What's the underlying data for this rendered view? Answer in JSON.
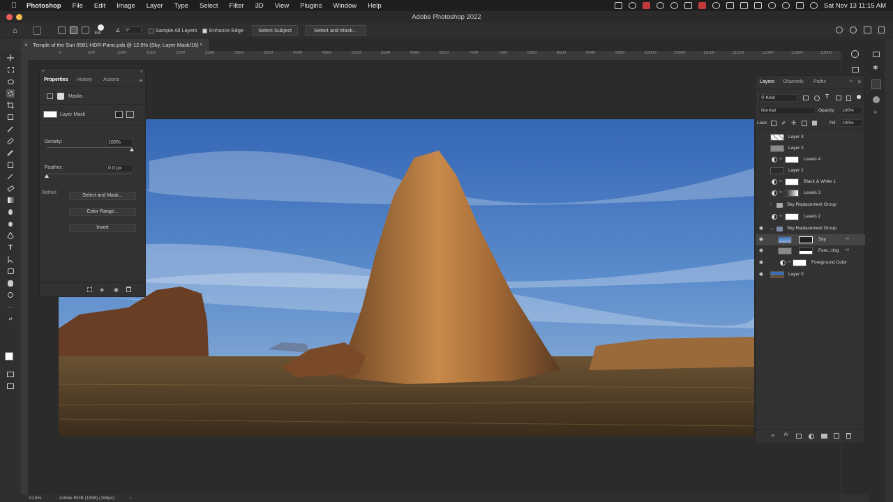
{
  "menubar": {
    "app": "Photoshop",
    "items": [
      "File",
      "Edit",
      "Image",
      "Layer",
      "Type",
      "Select",
      "Filter",
      "3D",
      "View",
      "Plugins",
      "Window",
      "Help"
    ],
    "clock": "Sat Nov 13  11:15 AM"
  },
  "window": {
    "title": "Adobe Photoshop 2022"
  },
  "options_bar": {
    "brush_size": "800",
    "angle": "0°",
    "sample_all_layers": "Sample All Layers",
    "enhance_edge": "Enhance Edge",
    "select_subject": "Select Subject",
    "select_and_mask": "Select and Mask..."
  },
  "document": {
    "tab_title": "Temple of the Sun 0581-HDR-Pano.psb @ 12.5% (Sky, Layer Mask/16) *"
  },
  "ruler": {
    "ticks": [
      "0",
      "500",
      "1000",
      "1500",
      "2000",
      "2500",
      "3000",
      "3500",
      "4000",
      "4500",
      "5000",
      "5500",
      "6000",
      "6500",
      "7000",
      "7500",
      "8000",
      "8500",
      "9000",
      "9500",
      "10000",
      "10500",
      "11000",
      "11500",
      "12000",
      "12500",
      "13000"
    ]
  },
  "properties": {
    "tabs": [
      "Properties",
      "History",
      "Actions"
    ],
    "masks_label": "Masks",
    "layer_mask_label": "Layer Mask",
    "density_label": "Density:",
    "density_value": "100%",
    "density_fraction": 1.0,
    "feather_label": "Feather:",
    "feather_value": "0.0 px",
    "feather_fraction": 0.0,
    "refine_label": "Refine:",
    "select_and_mask": "Select and Mask...",
    "color_range": "Color Range...",
    "invert": "Invert"
  },
  "layers_panel": {
    "tabs": [
      "Layers",
      "Channels",
      "Paths"
    ],
    "kind": "Kind",
    "blend_mode": "Normal",
    "opacity_label": "Opacity:",
    "opacity_value": "100%",
    "lock_label": "Lock:",
    "fill_label": "Fill:",
    "fill_value": "100%",
    "layers": [
      {
        "name": "Layer 3"
      },
      {
        "name": "Layer 2"
      },
      {
        "name": "Levels 4"
      },
      {
        "name": "Layer 1"
      },
      {
        "name": "Black & White 1"
      },
      {
        "name": "Levels 3"
      },
      {
        "name": "Sky Replacement Group"
      },
      {
        "name": "Levels 2"
      },
      {
        "name": "Sky Replacement Group"
      },
      {
        "name": "Sky"
      },
      {
        "name": "Fore...ting"
      },
      {
        "name": "Foreground Color"
      },
      {
        "name": "Layer 0"
      }
    ]
  },
  "status_bar": {
    "zoom": "12.5%",
    "profile": "Adobe RGB (1998) (16bpc)"
  }
}
